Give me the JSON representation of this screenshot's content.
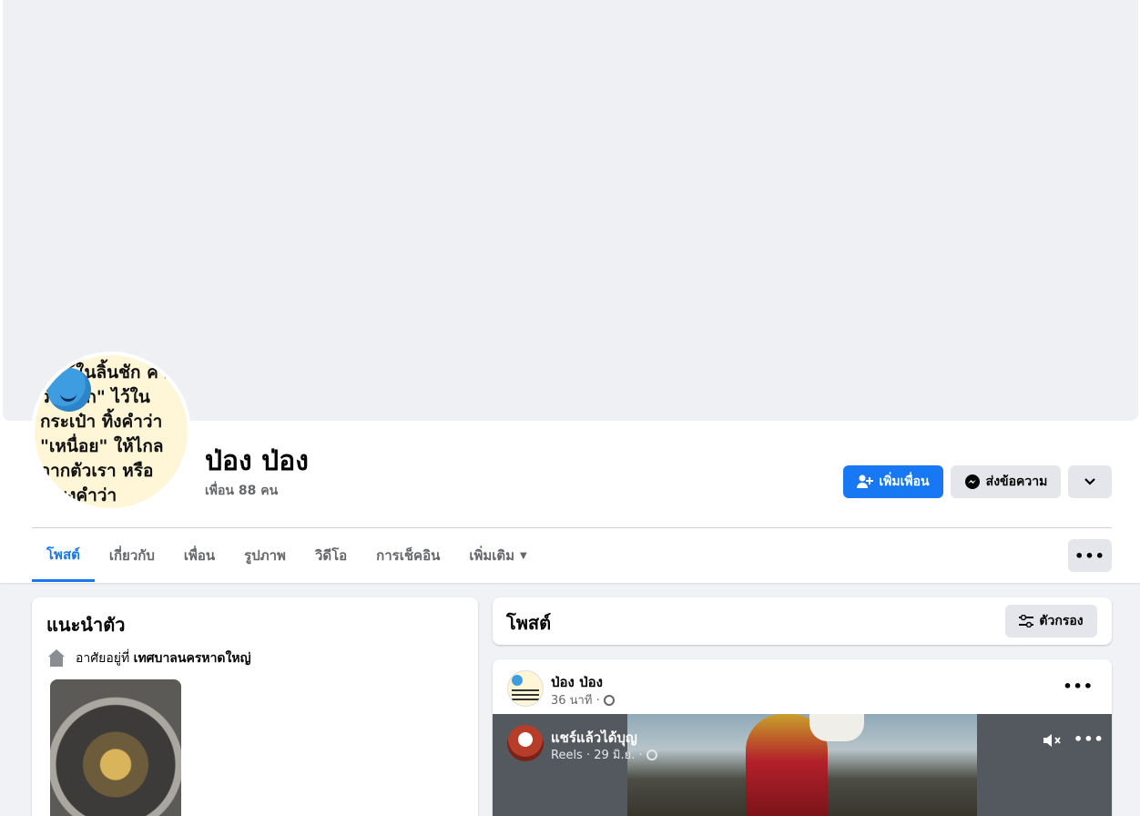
{
  "profile": {
    "name": "ป่อง ป่อง",
    "friends": "เพื่อน 88 คน",
    "avatar_text": "…ไว้ในลิ้นชัก คำว่า \"พัก\" ไว้ในกระเป๋า ทิ้งคำว่า \"เหนื่อย\" ให้ไกลจากตัวเรา หรือเพียงคำว่า"
  },
  "actions": {
    "add_friend": "เพิ่มเพื่อน",
    "message": "ส่งข้อความ"
  },
  "tabs": [
    {
      "label": "โพสต์"
    },
    {
      "label": "เกี่ยวกับ"
    },
    {
      "label": "เพื่อน"
    },
    {
      "label": "รูปภาพ"
    },
    {
      "label": "วิดีโอ"
    },
    {
      "label": "การเช็คอิน"
    },
    {
      "label": "เพิ่มเติม"
    }
  ],
  "intro": {
    "title": "แนะนำตัว",
    "lives_prefix": "อาศัยอยู่ที่",
    "lives_place": "เทศบาลนครหาดใหญ่"
  },
  "posts_header": {
    "title": "โพสต์",
    "filter": "ตัวกรอง"
  },
  "post": {
    "author": "ป่อง ป่อง",
    "time": "36 นาที ·",
    "reel": {
      "title": "แชร์แล้วได้บุญ",
      "meta": "Reels · 29 มิ.ย. ·"
    }
  },
  "colors": {
    "accent": "#1877f2",
    "background": "#f0f2f5",
    "button_gray": "#e4e6eb"
  },
  "icons": [
    "person-plus-icon",
    "messenger-icon",
    "chevron-down-icon",
    "more-dots-icon",
    "filter-icon",
    "home-icon",
    "globe-icon",
    "mute-icon"
  ]
}
